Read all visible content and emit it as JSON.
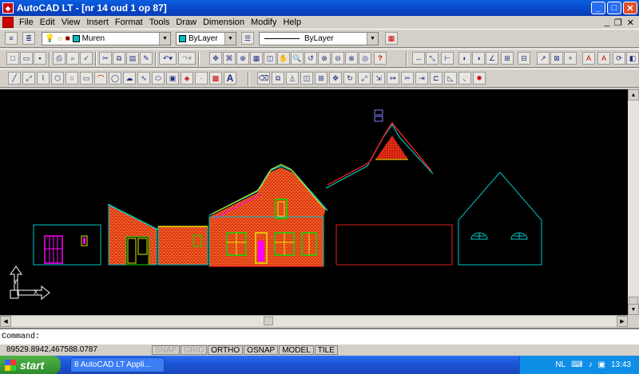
{
  "window": {
    "title": "AutoCAD LT - [nr 14 oud 1 op 87]"
  },
  "menu": {
    "items": [
      "File",
      "Edit",
      "View",
      "Insert",
      "Format",
      "Tools",
      "Draw",
      "Dimension",
      "Modify",
      "Help"
    ]
  },
  "properties": {
    "layer_value": "Muren",
    "color_value": "ByLayer",
    "linetype_value": "ByLayer",
    "layer_color": "#00c0c0"
  },
  "command": {
    "prompt": "Command:"
  },
  "status": {
    "coords": "89529.8942,467588.0787",
    "toggles": [
      "SNAP",
      "GRID",
      "ORTHO",
      "OSNAP",
      "MODEL",
      "TILE"
    ]
  },
  "taskbar": {
    "start_label": "start",
    "task_label": "8 AutoCAD LT Appli...",
    "lang": "NL",
    "clock": "13:43"
  },
  "colors": {
    "drawing_bg": "#000000",
    "cyan": "#00c8c8",
    "red": "#e02020",
    "magenta": "#ff00ff",
    "yellow": "#e6e600",
    "green": "#00e000"
  }
}
